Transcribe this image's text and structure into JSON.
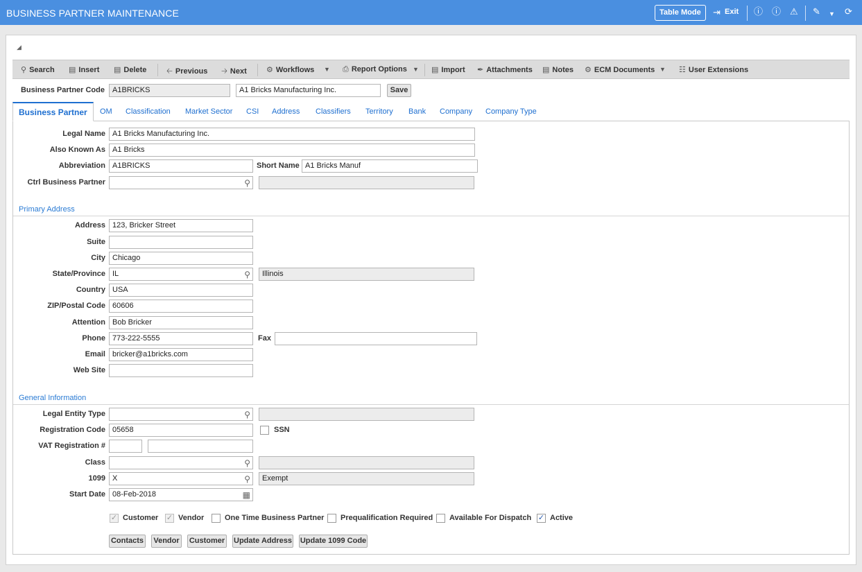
{
  "header": {
    "title": "BUSINESS PARTNER MAINTENANCE",
    "table_mode": "Table Mode",
    "exit": "Exit"
  },
  "toolbar": {
    "search": "Search",
    "insert": "Insert",
    "delete": "Delete",
    "previous": "Previous",
    "next": "Next",
    "workflows": "Workflows",
    "report_options": "Report Options",
    "import": "Import",
    "attachments": "Attachments",
    "notes": "Notes",
    "ecm_documents": "ECM Documents",
    "user_extensions": "User Extensions"
  },
  "key": {
    "label": "Business Partner Code",
    "code": "A1BRICKS",
    "name": "A1 Bricks Manufacturing Inc.",
    "save": "Save"
  },
  "tabs": [
    "Business Partner",
    "OM",
    "Classification",
    "Market Sector",
    "CSI",
    "Address",
    "Classifiers",
    "Territory",
    "Bank",
    "Company",
    "Company Type"
  ],
  "general": {
    "legal_name_label": "Legal Name",
    "legal_name": "A1 Bricks Manufacturing Inc.",
    "aka_label": "Also Known As",
    "aka": "A1 Bricks",
    "abbreviation_label": "Abbreviation",
    "abbreviation": "A1BRICKS",
    "short_name_label": "Short Name",
    "short_name": "A1 Bricks Manuf",
    "ctrl_bp_label": "Ctrl Business Partner",
    "ctrl_bp": "",
    "ctrl_bp_desc": ""
  },
  "primary_address": {
    "title": "Primary Address",
    "address_label": "Address",
    "address": "123, Bricker Street",
    "suite_label": "Suite",
    "suite": "",
    "city_label": "City",
    "city": "Chicago",
    "state_label": "State/Province",
    "state": "IL",
    "state_desc": "Illinois",
    "country_label": "Country",
    "country": "USA",
    "zip_label": "ZIP/Postal Code",
    "zip": "60606",
    "attention_label": "Attention",
    "attention": "Bob Bricker",
    "phone_label": "Phone",
    "phone": "773-222-5555",
    "fax_label": "Fax",
    "fax": "",
    "email_label": "Email",
    "email": "bricker@a1bricks.com",
    "website_label": "Web Site",
    "website": ""
  },
  "general_info": {
    "title": "General Information",
    "legal_entity_label": "Legal Entity Type",
    "legal_entity": "",
    "legal_entity_desc": "",
    "reg_code_label": "Registration Code",
    "reg_code": "05658",
    "ssn_label": "SSN",
    "vat_label": "VAT Registration #",
    "vat_1": "",
    "vat_2": "",
    "class_label": "Class",
    "class": "",
    "class_desc": "",
    "t1099_label": "1099",
    "t1099": "X",
    "t1099_desc": "Exempt",
    "start_date_label": "Start Date",
    "start_date": "08-Feb-2018"
  },
  "checkboxes": [
    {
      "label": "Customer",
      "checked": true,
      "disabled": true
    },
    {
      "label": "Vendor",
      "checked": true,
      "disabled": true
    },
    {
      "label": "One Time Business Partner",
      "checked": false,
      "disabled": false
    },
    {
      "label": "Prequalification Required",
      "checked": false,
      "disabled": false
    },
    {
      "label": "Available For Dispatch",
      "checked": false,
      "disabled": false
    },
    {
      "label": "Active",
      "checked": true,
      "disabled": false
    }
  ],
  "buttons": {
    "contacts": "Contacts",
    "vendor": "Vendor",
    "customer": "Customer",
    "update_address": "Update Address",
    "update_1099": "Update 1099 Code"
  }
}
